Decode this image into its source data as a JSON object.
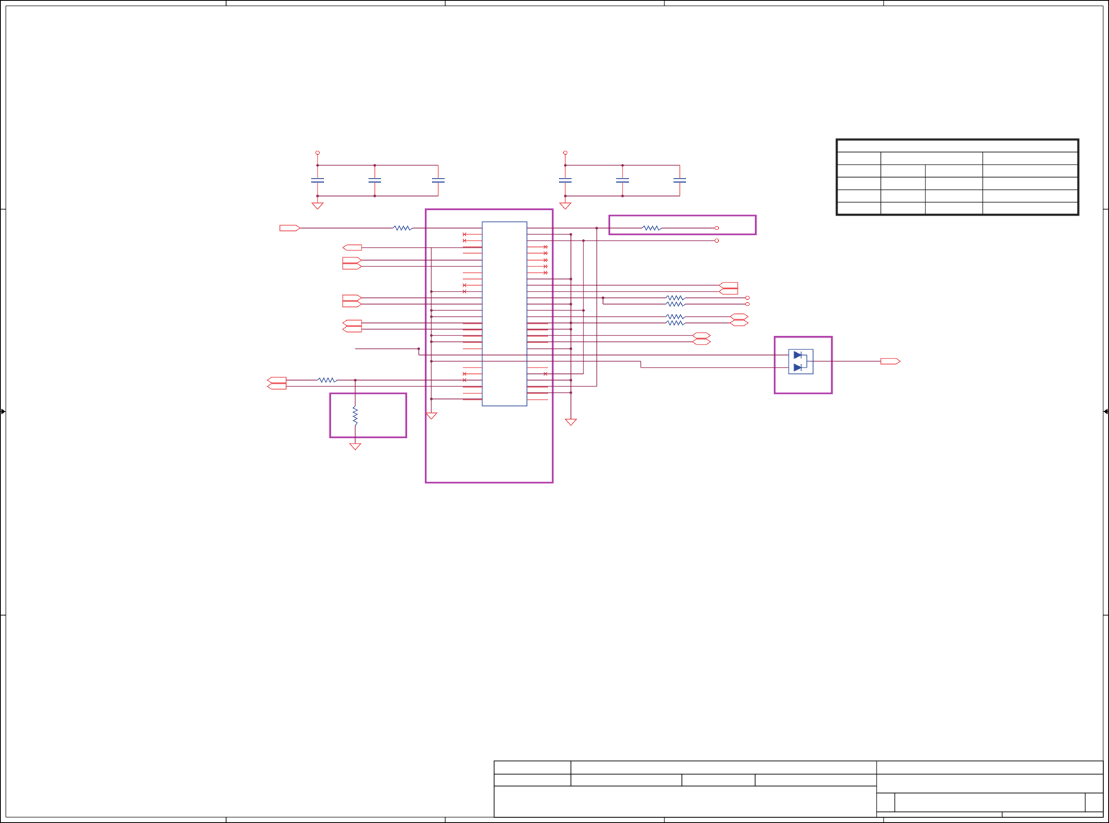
{
  "sheet": {
    "colors": {
      "frame": "#000000",
      "wire": "#8b1a4a",
      "component": "#e8383d",
      "part_body": "#2b4a9b",
      "block_outline": "#b03aa8",
      "table_border": "#1a1a1a"
    },
    "icons": [
      "ground-symbol-icon",
      "power-port-icon",
      "capacitor-icon",
      "resistor-icon",
      "diode-icon",
      "off-page-connector-icon",
      "no-connect-icon"
    ]
  }
}
